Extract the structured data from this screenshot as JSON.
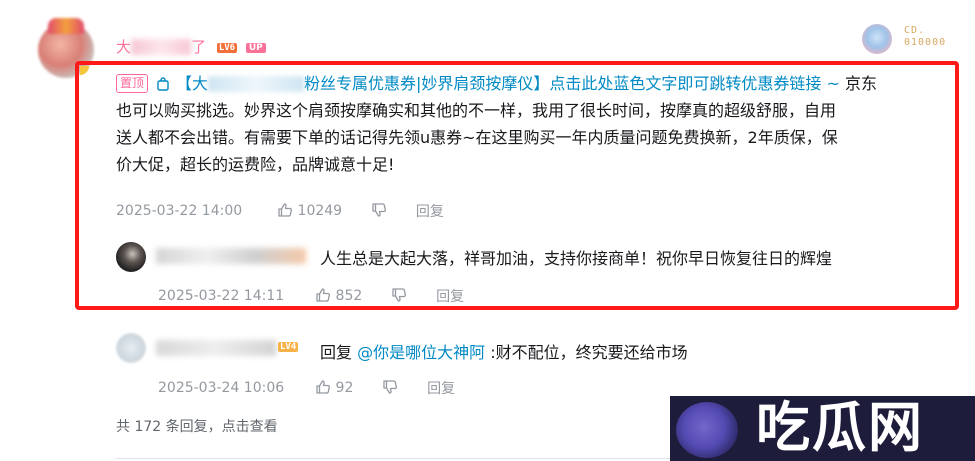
{
  "comment": {
    "username_visible": "大",
    "username_tail": "了",
    "level_badge": "LV6",
    "up_badge": "UP",
    "fan_medal_line1": "CD.",
    "fan_medal_line2": "010000",
    "pinned_label": "置顶",
    "link_prefix": "【大",
    "link_suffix": "粉丝专属优惠券|妙界肩颈按摩仪】点击此处蓝色文字即可跳转优惠券链接 ~",
    "line1_tail": " 京东",
    "line2": "也可以购买挑选。妙界这个肩颈按摩确实和其他的不一样，我用了很长时间，按摩真的超级舒服，自用",
    "line3": "送人都不会出错。有需要下单的话记得先领u惠券~在这里购买一年内质量问题免费换新，2年质保，保",
    "line4": "价大促，超长的运费险，品牌诚意十足!",
    "date": "2025-03-22 14:00",
    "likes": "10249",
    "reply_label": "回复"
  },
  "replies": [
    {
      "text": "人生总是大起大落，祥哥加油，支持你接商单！祝你早日恢复往日的辉煌",
      "date": "2025-03-22 14:11",
      "likes": "852",
      "reply_label": "回复"
    },
    {
      "level_badge": "LV4",
      "reply_prefix": "回复 ",
      "mention": "@你是哪位大神阿",
      "text": " :财不配位，终究要还给市场",
      "date": "2025-03-24 10:06",
      "likes": "92",
      "reply_label": "回复"
    }
  ],
  "footer": {
    "more_replies": "共 172 条回复，点击查看"
  },
  "watermark": {
    "text": "吃瓜网"
  },
  "colors": {
    "accent_pink": "#fb7299",
    "link_blue": "#008ac5",
    "highlight_red": "#ff1a1a",
    "meta_gray": "#9499a0"
  }
}
